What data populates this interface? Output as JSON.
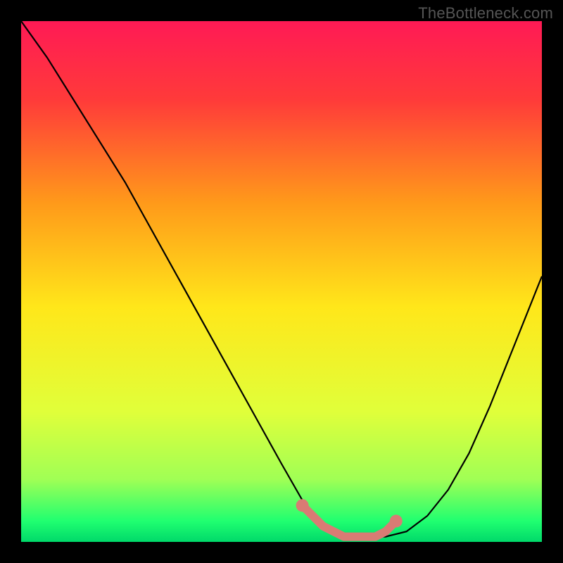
{
  "watermark": "TheBottleneck.com",
  "chart_data": {
    "type": "line",
    "title": "",
    "xlabel": "",
    "ylabel": "",
    "x_range": [
      0,
      100
    ],
    "y_range": [
      0,
      100
    ],
    "gradient_stops": [
      {
        "offset": 0,
        "color": "#ff1a55"
      },
      {
        "offset": 15,
        "color": "#ff3a3a"
      },
      {
        "offset": 35,
        "color": "#ff9a1a"
      },
      {
        "offset": 55,
        "color": "#ffe71a"
      },
      {
        "offset": 75,
        "color": "#e0ff3a"
      },
      {
        "offset": 88,
        "color": "#a0ff55"
      },
      {
        "offset": 96,
        "color": "#20ff70"
      },
      {
        "offset": 100,
        "color": "#00d96a"
      }
    ],
    "series": [
      {
        "name": "bottleneck-curve",
        "stroke": "#000000",
        "x": [
          0,
          5,
          10,
          15,
          20,
          25,
          30,
          35,
          40,
          45,
          50,
          54,
          58,
          62,
          66,
          70,
          74,
          78,
          82,
          86,
          90,
          94,
          98,
          100
        ],
        "y": [
          100,
          93,
          85,
          77,
          69,
          60,
          51,
          42,
          33,
          24,
          15,
          8,
          3,
          1,
          1,
          1,
          2,
          5,
          10,
          17,
          26,
          36,
          46,
          51
        ]
      }
    ],
    "highlight": {
      "name": "optimal-zone",
      "stroke": "#d97b74",
      "x": [
        54,
        58,
        62,
        64,
        66,
        68,
        70,
        72
      ],
      "y": [
        7,
        3,
        1,
        1,
        1,
        1,
        2,
        4
      ]
    }
  }
}
